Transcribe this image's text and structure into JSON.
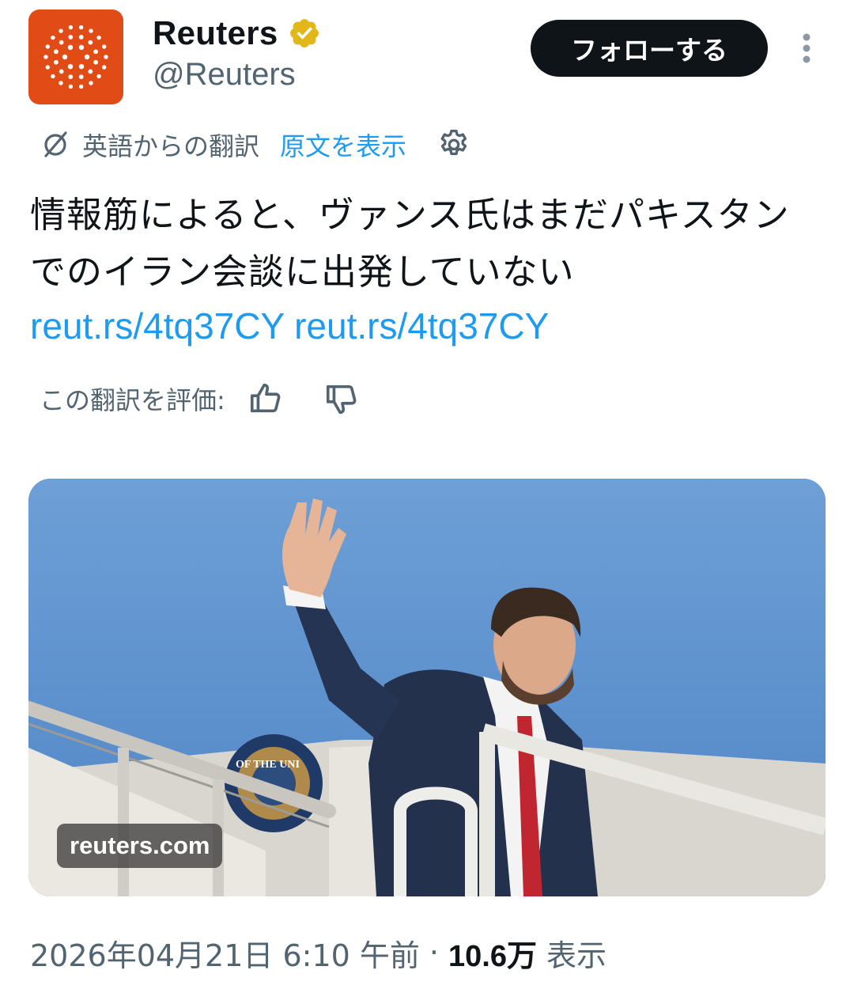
{
  "account": {
    "name": "Reuters",
    "handle": "@Reuters",
    "verified_color": "#e2b719",
    "avatar_bg": "#e04b16",
    "avatar_icon": "reuters-dots-logo"
  },
  "header": {
    "follow_label": "フォローする",
    "more_icon": "vertical-ellipsis-icon"
  },
  "translation": {
    "icon": "translate-slash-icon",
    "translated_from": "英語からの翻訳",
    "show_original": "原文を表示",
    "settings_icon": "gear-icon",
    "rate_label": "この翻訳を評価:",
    "thumbs_up_icon": "thumbs-up-icon",
    "thumbs_down_icon": "thumbs-down-icon"
  },
  "tweet": {
    "text": "情報筋によると、ヴァンス氏はまだパキスタンでのイラン会談に出発していない",
    "links": [
      "reut.rs/4tq37CY",
      "reut.rs/4tq37CY"
    ],
    "link_color": "#1d9bf0"
  },
  "media": {
    "source_badge": "reuters.com",
    "seal_text": "OF THE UNI"
  },
  "meta": {
    "timestamp": "2026年04月21日 6:10 午前",
    "separator": "·",
    "views_count": "10.6万",
    "views_label": "表示"
  }
}
